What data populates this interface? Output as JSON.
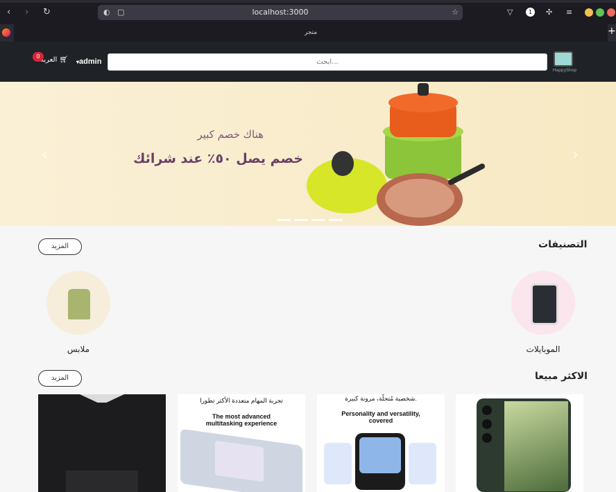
{
  "browser": {
    "url": "localhost:3000",
    "tab_title": "متجر",
    "extension_badge": "1",
    "new_tab": "+"
  },
  "header": {
    "logo_text": "HappyShop",
    "search_placeholder": "ابحث...",
    "user_label": "admin",
    "cart_label": "العربة",
    "cart_count": "0"
  },
  "hero": {
    "line1": "هناك خصم كبير",
    "line2": "خصم يصل ٥٠٪ عند شرائك"
  },
  "categories": {
    "title": "التصنيفات",
    "more_label": "المزيد",
    "items": [
      {
        "label": "الموبايلات"
      },
      {
        "label": "ملابس"
      }
    ]
  },
  "bestsellers": {
    "title": "الاكثر مبيعا",
    "more_label": "المزيد",
    "products": [
      {
        "text_ar": "",
        "text_en": ""
      },
      {
        "text_ar": "شخصية مُتجلّة، مرونة كبيرة.",
        "text_en": "Personality and versatility, covered"
      },
      {
        "text_ar": "تجربة المهام متعددة الأكثر تطورا",
        "text_en": "The most advanced multitasking experience"
      },
      {
        "text_ar": "",
        "text_en": ""
      }
    ]
  },
  "colors": {
    "header_bg": "#1f2226",
    "badge": "#d9263a",
    "hero_text": "#6a3f66"
  }
}
